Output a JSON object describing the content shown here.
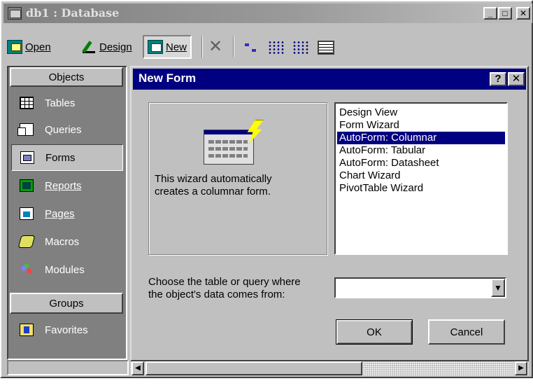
{
  "window": {
    "title": "db1 : Database",
    "minimize_glyph": "_",
    "maximize_glyph": "□",
    "close_glyph": "✕"
  },
  "toolbar": {
    "open_label": "Open",
    "design_label": "Design",
    "new_label": "New",
    "delete_glyph": "✕"
  },
  "objects_bar": {
    "header": "Objects",
    "items": [
      {
        "label": "Tables",
        "icon": "table-icon"
      },
      {
        "label": "Queries",
        "icon": "query-icon"
      },
      {
        "label": "Forms",
        "icon": "form-icon",
        "selected": true
      },
      {
        "label": "Reports",
        "icon": "report-icon"
      },
      {
        "label": "Pages",
        "icon": "page-icon"
      },
      {
        "label": "Macros",
        "icon": "macro-icon"
      },
      {
        "label": "Modules",
        "icon": "module-icon"
      }
    ],
    "groups_header": "Groups",
    "groups": [
      {
        "label": "Favorites",
        "icon": "favorites-icon"
      }
    ]
  },
  "dialog": {
    "title": "New Form",
    "help_glyph": "?",
    "close_glyph": "✕",
    "description": "This wizard automatically\ncreates a columnar form.",
    "options": [
      "Design View",
      "Form Wizard",
      "AutoForm:  Columnar",
      "AutoForm:  Tabular",
      "AutoForm:  Datasheet",
      "Chart Wizard",
      "PivotTable Wizard"
    ],
    "selected_option": "AutoForm:  Columnar",
    "source_label": "Choose the table or query where\nthe object's data comes from:",
    "source_value": "",
    "ok_label": "OK",
    "cancel_label": "Cancel"
  },
  "colors": {
    "title_active": "#000080",
    "face": "#c0c0c0",
    "objects_bar_bg": "#808080",
    "selection": "#000080"
  }
}
